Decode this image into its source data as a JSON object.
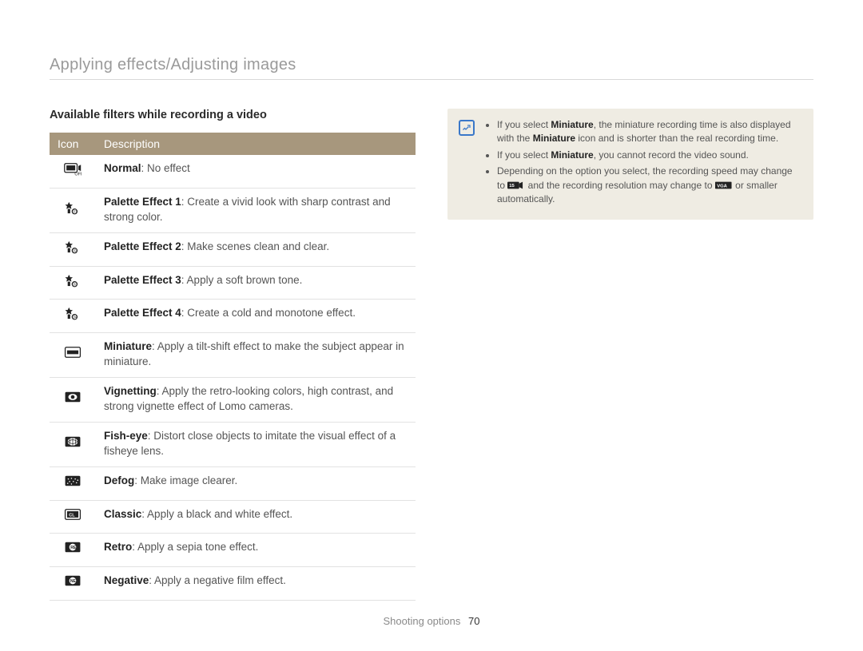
{
  "page_title": "Applying effects/Adjusting images",
  "section_title": "Available filters while recording a video",
  "table": {
    "headers": {
      "icon": "Icon",
      "description": "Description"
    },
    "rows": [
      {
        "icon": "off",
        "name": "Normal",
        "desc": ": No effect"
      },
      {
        "icon": "pal1",
        "name": "Palette Effect 1",
        "desc": ": Create a vivid look with sharp contrast and strong color."
      },
      {
        "icon": "pal2",
        "name": "Palette Effect 2",
        "desc": ": Make scenes clean and clear."
      },
      {
        "icon": "pal3",
        "name": "Palette Effect 3",
        "desc": ": Apply a soft brown tone."
      },
      {
        "icon": "pal4",
        "name": "Palette Effect 4",
        "desc": ": Create a cold and monotone effect."
      },
      {
        "icon": "mini",
        "name": "Miniature",
        "desc": ": Apply a tilt-shift effect to make the subject appear in miniature."
      },
      {
        "icon": "vig",
        "name": "Vignetting",
        "desc": ": Apply the retro-looking colors, high contrast, and strong vignette effect of Lomo cameras."
      },
      {
        "icon": "fish",
        "name": "Fish-eye",
        "desc": ": Distort close objects to imitate the visual effect of a fisheye lens."
      },
      {
        "icon": "defog",
        "name": "Defog",
        "desc": ": Make image clearer."
      },
      {
        "icon": "classic",
        "name": "Classic",
        "desc": ": Apply a black and white effect."
      },
      {
        "icon": "retro",
        "name": "Retro",
        "desc": ": Apply a sepia tone effect."
      },
      {
        "icon": "negative",
        "name": "Negative",
        "desc": ": Apply a negative film effect."
      }
    ]
  },
  "note": {
    "items": [
      {
        "pre": "If you select ",
        "b1": "Miniature",
        "mid": ", the miniature recording time is also displayed with the ",
        "b2": "Miniature",
        "post": " icon and is shorter than the real recording time."
      },
      {
        "pre": "If you select ",
        "b1": "Miniature",
        "mid": ", you cannot record the video sound.",
        "b2": "",
        "post": ""
      },
      {
        "pre": "Depending on the option you select, the recording speed may change to ",
        "icon1": "rec15",
        "mid": " and the recording resolution may change to ",
        "icon2": "vga",
        "post": " or smaller automatically."
      }
    ]
  },
  "footer": {
    "section": "Shooting options",
    "page": "70"
  }
}
